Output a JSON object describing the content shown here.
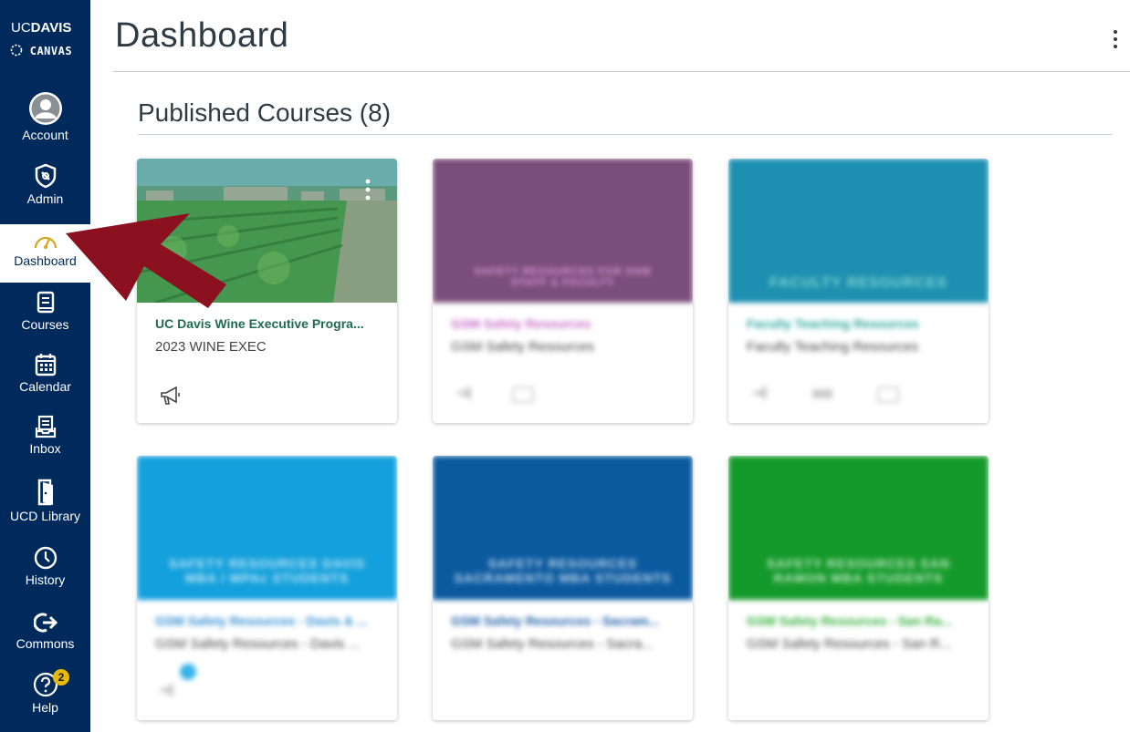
{
  "logo": {
    "uc": "UC",
    "davis": "DAVIS",
    "canvas": "CANVAS"
  },
  "nav": [
    {
      "key": "account",
      "label": "Account",
      "icon": "account-icon"
    },
    {
      "key": "admin",
      "label": "Admin",
      "icon": "admin-shield-icon"
    },
    {
      "key": "dashboard",
      "label": "Dashboard",
      "icon": "dashboard-gauge-icon",
      "active": true
    },
    {
      "key": "courses",
      "label": "Courses",
      "icon": "courses-book-icon"
    },
    {
      "key": "calendar",
      "label": "Calendar",
      "icon": "calendar-icon"
    },
    {
      "key": "inbox",
      "label": "Inbox",
      "icon": "inbox-icon"
    },
    {
      "key": "library",
      "label": "UCD Library",
      "icon": "library-door-icon"
    },
    {
      "key": "history",
      "label": "History",
      "icon": "history-clock-icon"
    },
    {
      "key": "commons",
      "label": "Commons",
      "icon": "commons-arrow-icon"
    },
    {
      "key": "help",
      "label": "Help",
      "icon": "help-question-icon",
      "badge": "2"
    }
  ],
  "page": {
    "title": "Dashboard",
    "section_title": "Published Courses (8)"
  },
  "colors": {
    "sidebar": "#002a5c",
    "arrow": "#8b1020",
    "wine_title": "#2b7a5e"
  },
  "cards": [
    {
      "title": "UC Davis Wine Executive Progra...",
      "subtitle": "2023 WINE EXEC",
      "hero_text": "",
      "hero_color": "#3e8a4a",
      "title_color": "#1f6b52",
      "blurred": false
    },
    {
      "title": "GSM Safety Resources",
      "subtitle": "GSM Safety Resources",
      "hero_text": "SAFETY RESOURCES FOR GSM STAFF & FACULTY",
      "hero_color": "#7a4e7a",
      "title_color": "#c86cc8",
      "blurred": true
    },
    {
      "title": "Faculty Teaching Resources",
      "subtitle": "Faculty Teaching Resources",
      "hero_text": "FACULTY RESOURCES",
      "hero_color": "#1d8fb0",
      "title_color": "#2aa8a0",
      "blurred": true
    },
    {
      "title": "GSM Safety Resources - Davis & ...",
      "subtitle": "GSM Safety Resources - Davis ...",
      "hero_text": "SAFETY RESOURCES DAVIS MBA / MPAc STUDENTS",
      "hero_color": "#14a0dc",
      "title_color": "#2f8ed6",
      "blurred": true
    },
    {
      "title": "GSM Safety Resources - Sacram...",
      "subtitle": "GSM Safety Resources - Sacra...",
      "hero_text": "SAFETY RESOURCES SACRAMENTO MBA STUDENTS",
      "hero_color": "#0b5aa0",
      "title_color": "#1b5fa8",
      "blurred": true
    },
    {
      "title": "GSM Safety Resources - San Ra...",
      "subtitle": "GSM Safety Resources - San R...",
      "hero_text": "SAFETY RESOURCES SAN RAMON MBA STUDENTS",
      "hero_color": "#149a2a",
      "title_color": "#33b03a",
      "blurred": true
    }
  ]
}
